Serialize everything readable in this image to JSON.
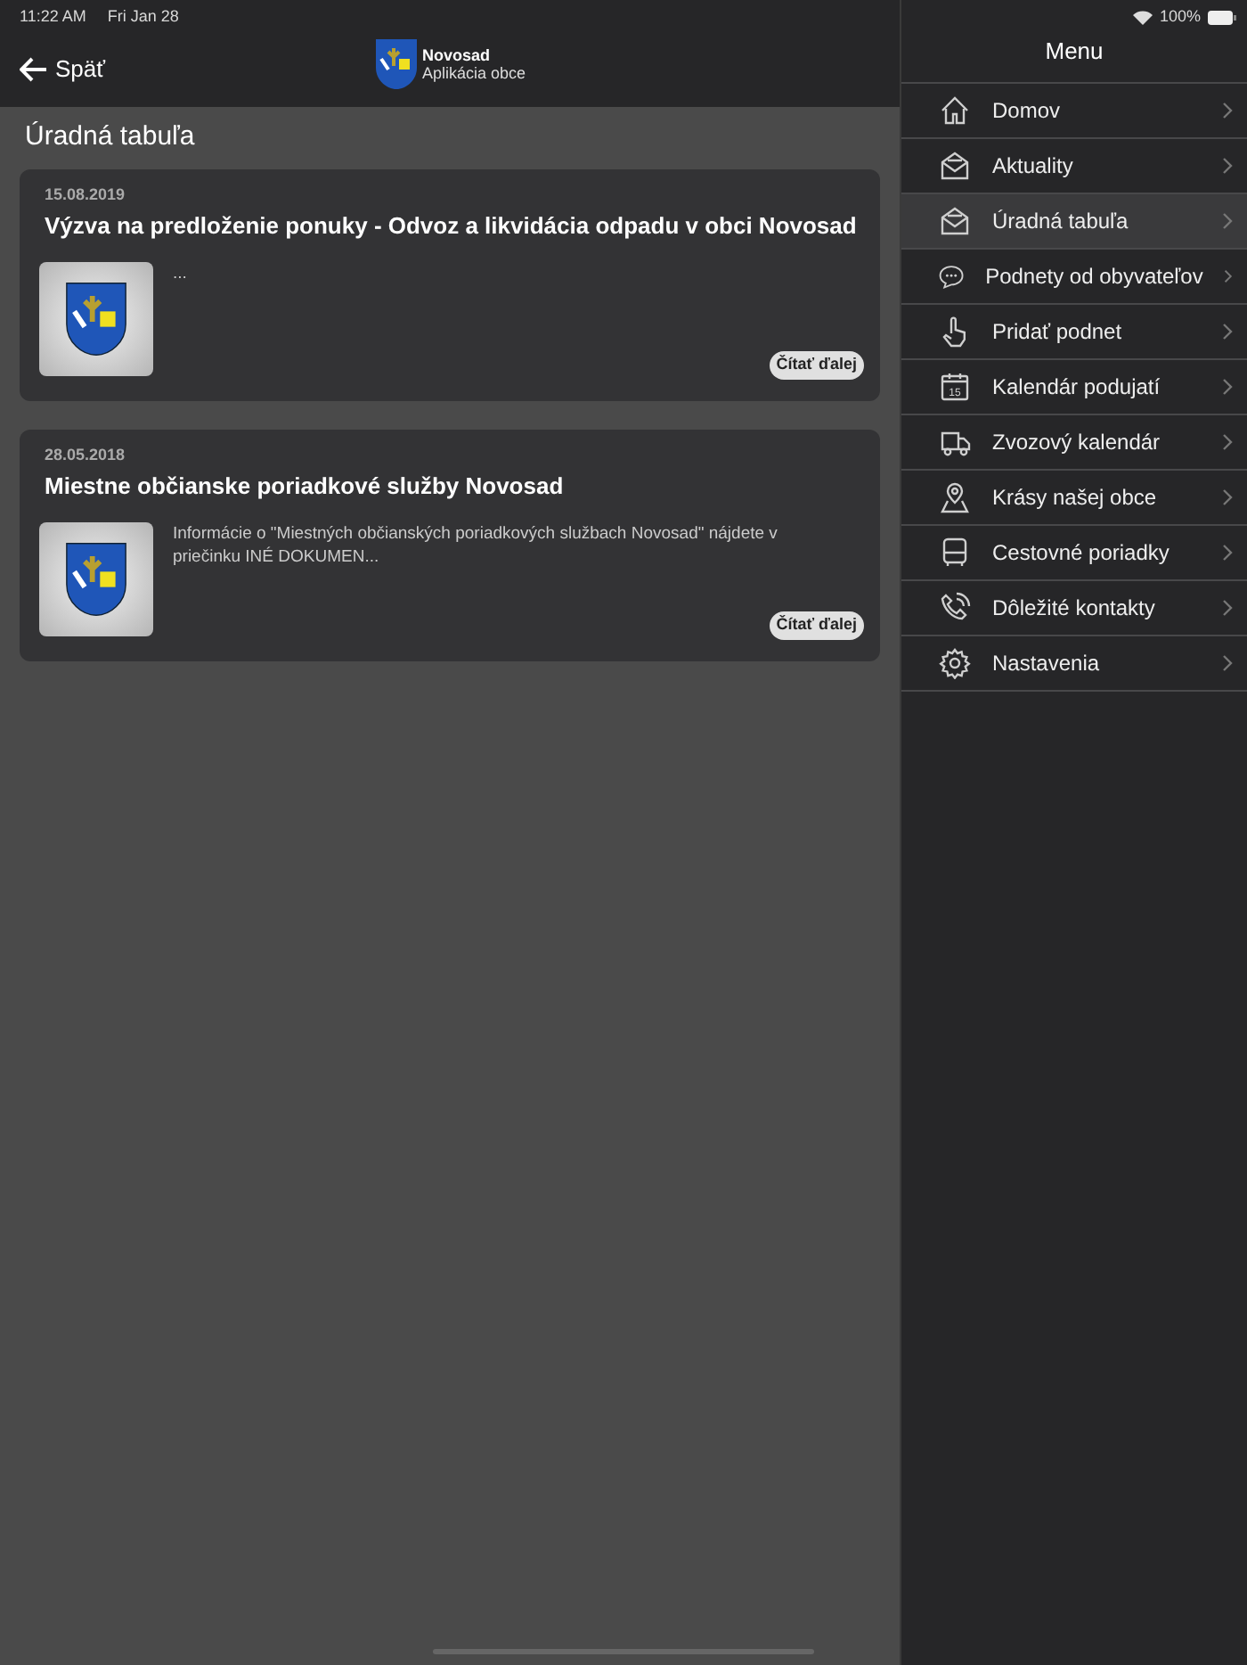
{
  "status_bar": {
    "time": "11:22 AM",
    "date": "Fri Jan 28",
    "battery": "100%"
  },
  "header": {
    "back": "Späť",
    "app_name": "Novosad",
    "app_subtitle": "Aplikácia obce"
  },
  "page_title": "Úradná tabuľa",
  "posts": [
    {
      "date": "15.08.2019",
      "title": "Výzva na predloženie ponuky - Odvoz a likvidácia odpadu v obci Novosad",
      "excerpt": "...",
      "button": "Čítať ďalej"
    },
    {
      "date": "28.05.2018",
      "title": "Miestne občianske poriadkové služby Novosad",
      "excerpt": "Informácie o \"Miestných občianských poriadkových službach Novosad\"  nájdete v priečinku INÉ DOKUMEN...",
      "button": "Čítať ďalej"
    }
  ],
  "menu": {
    "title": "Menu",
    "items": [
      {
        "kind": "home",
        "label": "Domov",
        "selected": false
      },
      {
        "kind": "envelope",
        "label": "Aktuality",
        "selected": false
      },
      {
        "kind": "envelope",
        "label": "Úradná tabuľa",
        "selected": true
      },
      {
        "kind": "chat",
        "label": "Podnety od obyvateľov",
        "selected": false
      },
      {
        "kind": "hand",
        "label": "Pridať podnet",
        "selected": false
      },
      {
        "kind": "calendar",
        "label": "Kalendár podujatí",
        "selected": false,
        "icon_text": "15"
      },
      {
        "kind": "truck",
        "label": "Zvozový kalendár",
        "selected": false
      },
      {
        "kind": "pin",
        "label": "Krásy našej obce",
        "selected": false
      },
      {
        "kind": "bus",
        "label": "Cestovné poriadky",
        "selected": false
      },
      {
        "kind": "phone",
        "label": "Dôležité kontakty",
        "selected": false
      },
      {
        "kind": "gear",
        "label": "Nastavenia",
        "selected": false
      }
    ]
  }
}
